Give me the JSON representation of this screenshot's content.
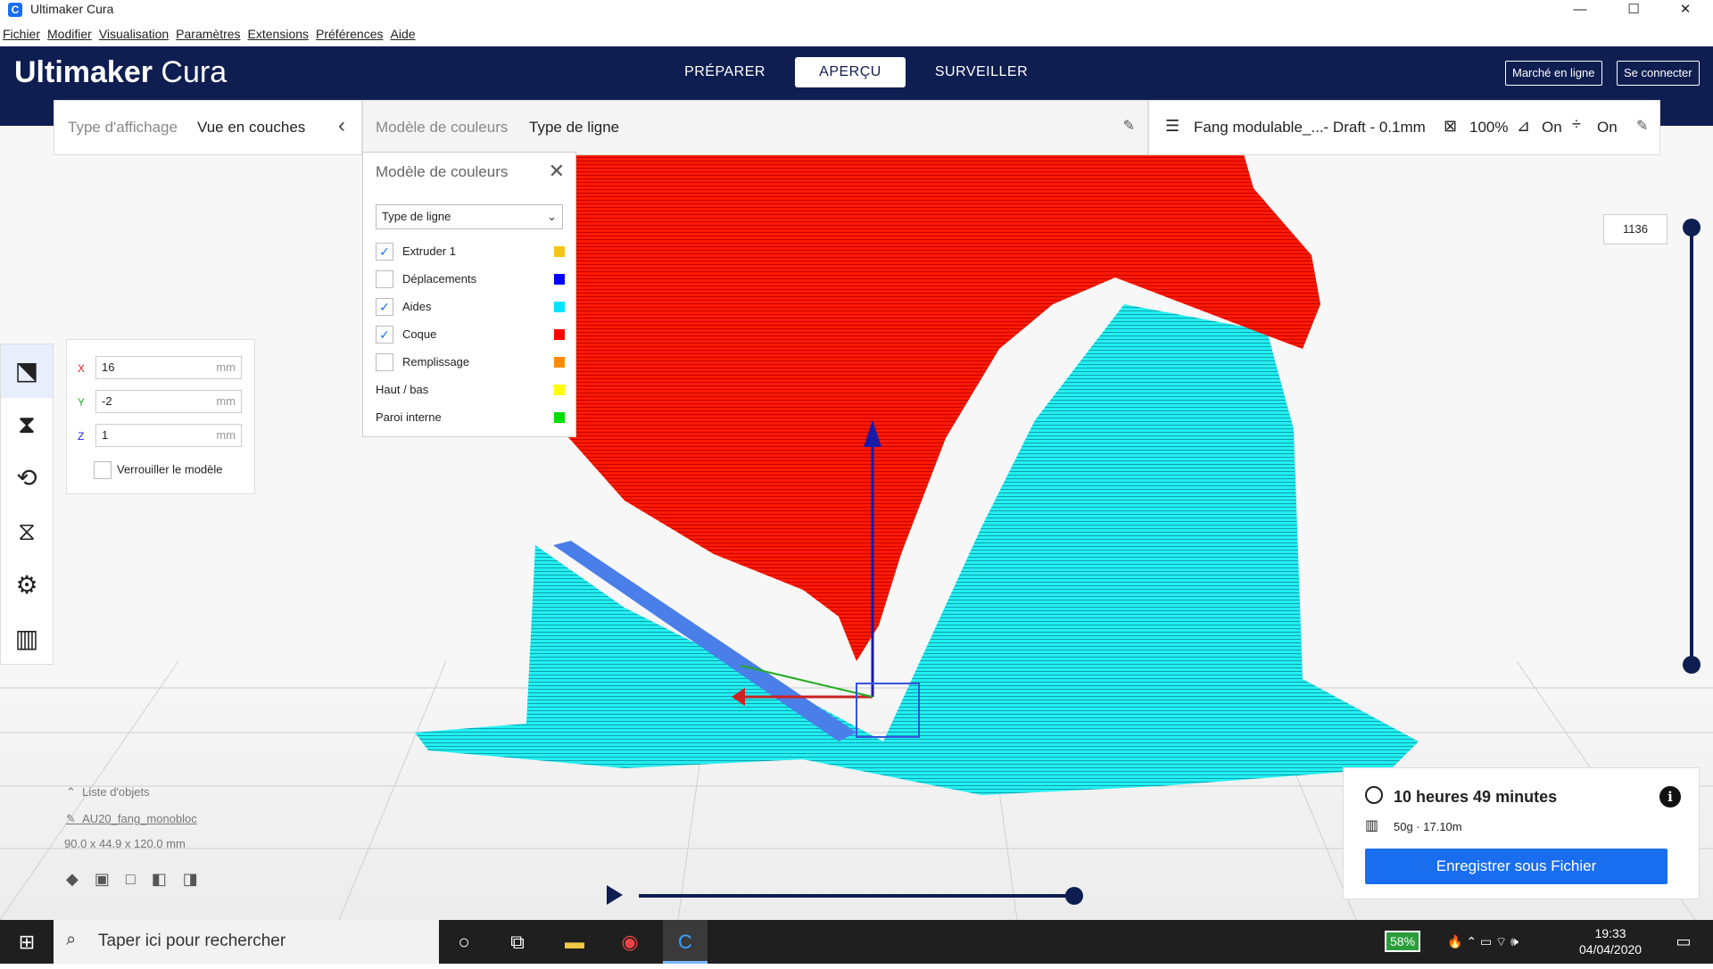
{
  "window": {
    "title": "Ultimaker Cura",
    "logo_letter": "C",
    "minimize": "—",
    "maximize": "☐",
    "close": "✕"
  },
  "menu": [
    "Fichier",
    "Modifier",
    "Visualisation",
    "Paramètres",
    "Extensions",
    "Préférences",
    "Aide"
  ],
  "header": {
    "brand_bold": "Ultimaker",
    "brand_light": "Cura",
    "stages": [
      {
        "label": "PRÉPARER"
      },
      {
        "label": "APERÇU",
        "active": true
      },
      {
        "label": "SURVEILLER"
      }
    ],
    "marketplace": "Marché en ligne",
    "signin": "Se connecter"
  },
  "view_panel": {
    "type_label": "Type d'affichage",
    "type_value": "Vue en couches"
  },
  "color_scheme_panel": {
    "label": "Modèle de couleurs",
    "value": "Type de ligne"
  },
  "print_setup": {
    "profile": "Fang modulable_...- Draft - 0.1mm",
    "infill": "100%",
    "support": "On",
    "adhesion": "On"
  },
  "color_popup": {
    "title": "Modèle de couleurs",
    "selected": "Type de ligne",
    "items": [
      {
        "label": "Extruder 1",
        "checkbox": true,
        "checked": true,
        "color": "#f5c518"
      },
      {
        "label": "Déplacements",
        "checkbox": true,
        "checked": false,
        "color": "#0000ff"
      },
      {
        "label": "Aides",
        "checkbox": true,
        "checked": true,
        "color": "#00e5ff"
      },
      {
        "label": "Coque",
        "checkbox": true,
        "checked": true,
        "color": "#ff0000"
      },
      {
        "label": "Remplissage",
        "checkbox": true,
        "checked": false,
        "color": "#ff8c00"
      },
      {
        "label": "Haut / bas",
        "checkbox": false,
        "color": "#ffff00"
      },
      {
        "label": "Paroi interne",
        "checkbox": false,
        "color": "#00dd00"
      }
    ]
  },
  "move_panel": {
    "x_label": "X",
    "x_value": "16",
    "y_label": "Y",
    "y_value": "-2",
    "z_label": "Z",
    "z_value": "1",
    "unit": "mm",
    "lock_label": "Verrouiller le modèle"
  },
  "object_info": {
    "list_label": "Liste d'objets",
    "name": "AU20_fang_monobloc",
    "dims": "90.0 x 44.9 x 120.0 mm"
  },
  "layer": {
    "current": "1136"
  },
  "print_info": {
    "time": "10 heures 49 minutes",
    "material": "50g · 17.10m",
    "save": "Enregistrer sous Fichier"
  },
  "taskbar": {
    "search": "Taper ici pour rechercher",
    "battery": "58%",
    "time": "19:33",
    "date": "04/04/2020"
  },
  "colors": {
    "header": "#0f1e51",
    "accent": "#196ef0",
    "model_red": "#ff0000",
    "support_cyan": "#00e5ff"
  }
}
